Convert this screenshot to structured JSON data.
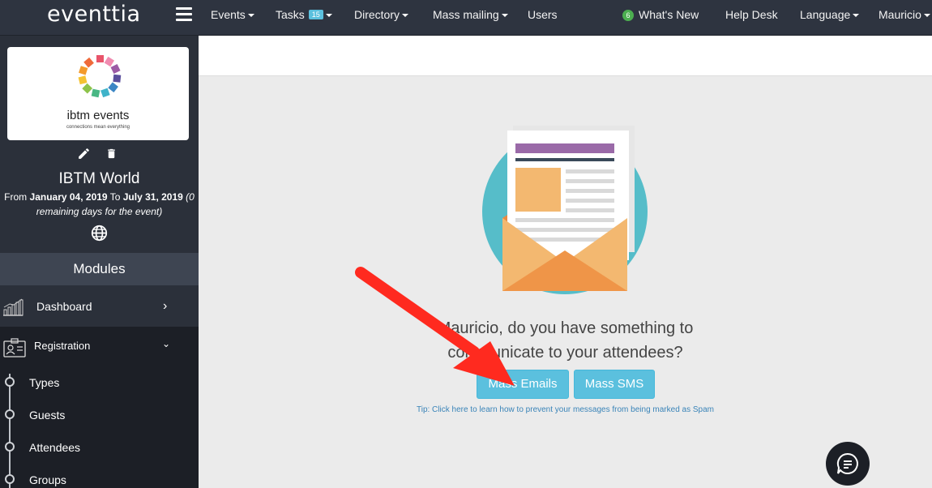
{
  "topbar": {
    "brand": "eventtia",
    "nav": {
      "events": "Events",
      "tasks": "Tasks",
      "tasks_badge": "15",
      "directory": "Directory",
      "mass_mailing": "Mass mailing",
      "users": "Users",
      "whats_new_badge": "6",
      "whats_new": "What's New",
      "help_desk": "Help Desk",
      "language": "Language",
      "user": "Mauricio"
    }
  },
  "sidebar": {
    "logo_text": "ibtm events",
    "logo_sub": "connections mean everything",
    "event_title": "IBTM World",
    "dates": {
      "from_label": "From",
      "from": "January 04, 2019",
      "to_label": "To",
      "to": "July 31, 2019",
      "remaining": "(0 remaining days for the event)"
    },
    "modules_label": "Modules",
    "dashboard": "Dashboard",
    "registration": "Registration",
    "sub_items": [
      "Types",
      "Guests",
      "Attendees",
      "Groups"
    ]
  },
  "main": {
    "question_line1": "Mauricio, do you have something to",
    "question_line2": "communicate to your attendees?",
    "mass_emails": "Mass Emails",
    "mass_sms": "Mass SMS",
    "tip": "Tip: Click here to learn how to prevent your messages from being marked as Spam"
  },
  "colors": {
    "topbar_bg": "#2e3440",
    "sidebar_bg": "#2b303a",
    "accent": "#5bc0de",
    "arrow": "#ff2a1f"
  }
}
